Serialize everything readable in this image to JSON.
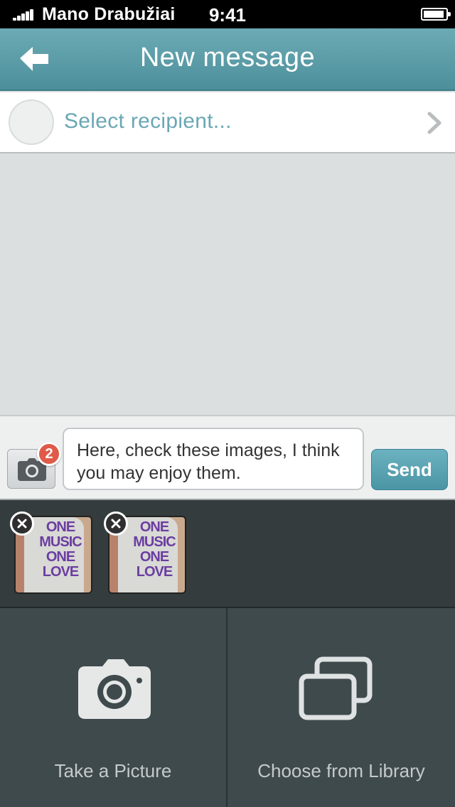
{
  "status_bar": {
    "carrier": "Mano Drabužiai",
    "time": "9:41"
  },
  "nav": {
    "title": "New message",
    "back_icon": "arrow-left-icon"
  },
  "recipient": {
    "placeholder": "Select recipient...",
    "chevron_icon": "chevron-right-icon"
  },
  "compose": {
    "attachment_count": "2",
    "message_text": "Here, check these images, I think you may enjoy them.",
    "send_label": "Send"
  },
  "attachments": [
    {
      "caption": "ONE MUSIC ONE LOVE"
    },
    {
      "caption": "ONE MUSIC ONE LOVE"
    }
  ],
  "actions": {
    "take_picture_label": "Take a Picture",
    "library_label": "Choose from Library"
  },
  "colors": {
    "nav_bar": "#5a9ea9",
    "accent": "#6aa7b4",
    "badge": "#e05a49",
    "panel": "#3f4a4d"
  }
}
